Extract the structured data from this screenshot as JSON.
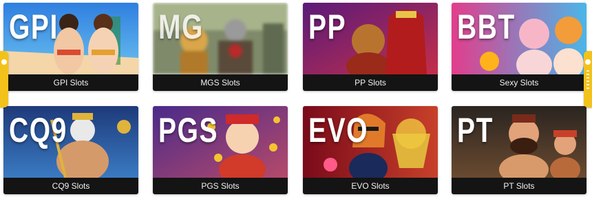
{
  "games": [
    {
      "brand": "GPI",
      "label": "GPI Slots",
      "accent": "#1f7ad6"
    },
    {
      "brand": "MG",
      "label": "MGS Slots",
      "accent": "#5d7a4a"
    },
    {
      "brand": "PP",
      "label": "PP Slots",
      "accent": "#8a1f6f"
    },
    {
      "brand": "BBT",
      "label": "Sexy Slots",
      "accent": "#e23d8c"
    },
    {
      "brand": "CQ9",
      "label": "CQ9 Slots",
      "accent": "#3a5aa8"
    },
    {
      "brand": "PGS",
      "label": "PGS Slots",
      "accent": "#6a4bb8"
    },
    {
      "brand": "EVO",
      "label": "EVO Slots",
      "accent": "#b4163a"
    },
    {
      "brand": "PT",
      "label": "PT Slots",
      "accent": "#c97a2a"
    }
  ],
  "side_tabs": {
    "left_icon": "chat-tab-icon",
    "right_icon": "menu-tab-icon"
  }
}
